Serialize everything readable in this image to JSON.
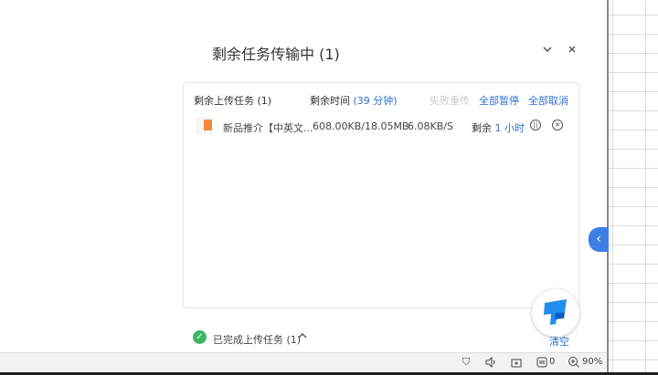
{
  "panel": {
    "title": "剩余任务传输中 (1)",
    "collapse_icon": "chevron-down-icon",
    "close_icon": "close-icon"
  },
  "tasks_header": {
    "remaining_label": "剩余上传任务",
    "remaining_count": "(1)",
    "time_label": "剩余时间",
    "time_value": "(39 分钟)",
    "retry_all": "失败重传",
    "pause_all": "全部暂停",
    "cancel_all": "全部取消"
  },
  "tasks": [
    {
      "file_name": "新品推介【中英文...",
      "progress": "608.00KB/18.05MB",
      "speed": "6.08KB/S",
      "remain_label": "剩余",
      "remain_time": "1 小时"
    }
  ],
  "completed": {
    "label": "已完成上传任务",
    "count": "(1)",
    "clear": "清空"
  },
  "statusbar": {
    "notif_count": "0",
    "zoom": "90%"
  },
  "colors": {
    "accent": "#2f6fd1",
    "side_tab": "#3d7fe6",
    "success": "#3fb561",
    "file_icon": "#f08a3c"
  }
}
